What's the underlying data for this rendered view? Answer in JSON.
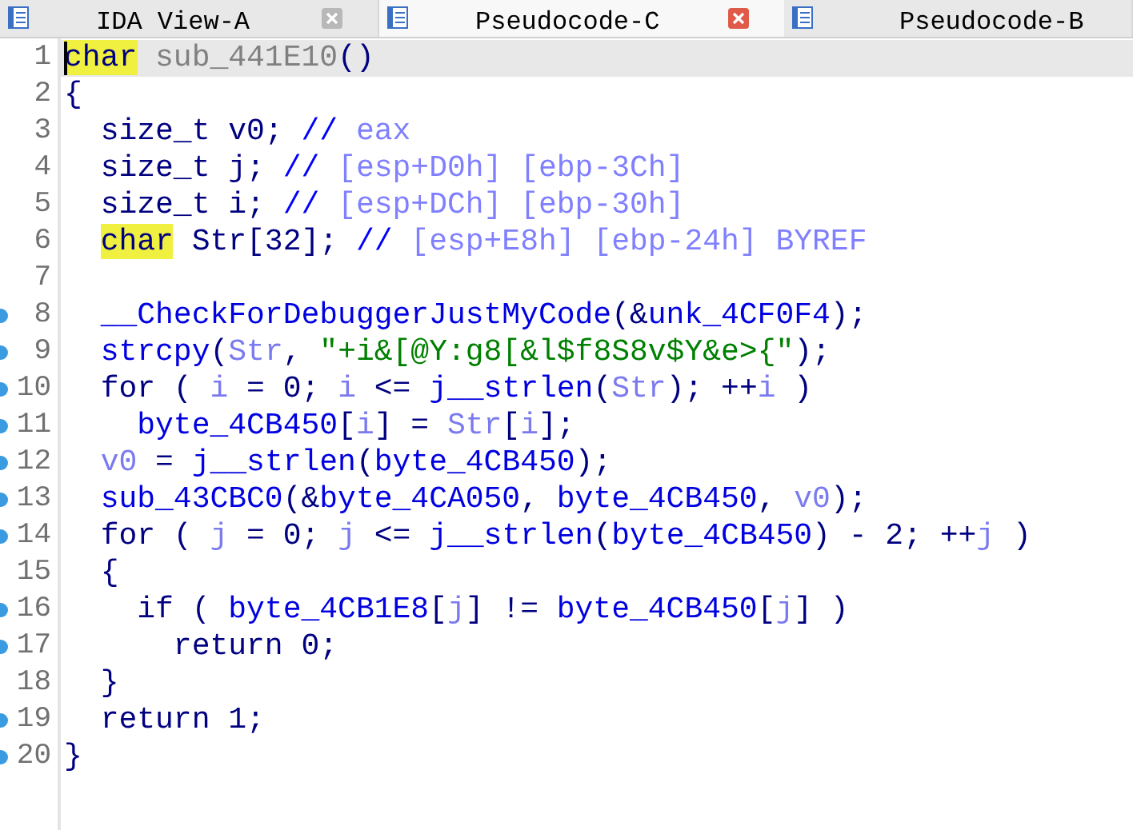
{
  "tabs": [
    {
      "label": "IDA View-A",
      "selected": false,
      "closable": true
    },
    {
      "label": "Pseudocode-C",
      "selected": true,
      "closable": true
    },
    {
      "label": "Pseudocode-B",
      "selected": false,
      "closable": false
    }
  ],
  "lines": [
    {
      "number": "1",
      "dot": false,
      "current": true,
      "segments": [
        {
          "kind": "highlight",
          "text": "char"
        },
        {
          "kind": "name",
          "text": " sub_441E10"
        },
        {
          "kind": "plain",
          "text": "()"
        }
      ]
    },
    {
      "number": "2",
      "dot": false,
      "current": false,
      "segments": [
        {
          "kind": "plain",
          "text": "{"
        }
      ]
    },
    {
      "number": "3",
      "dot": false,
      "current": false,
      "segments": [
        {
          "kind": "plain",
          "text": "  size_t v0; "
        },
        {
          "kind": "comment",
          "text": "// "
        },
        {
          "kind": "note",
          "text": "eax"
        }
      ]
    },
    {
      "number": "4",
      "dot": false,
      "current": false,
      "segments": [
        {
          "kind": "plain",
          "text": "  size_t j; "
        },
        {
          "kind": "comment",
          "text": "// "
        },
        {
          "kind": "note",
          "text": "[esp+D0h] [ebp-3Ch]"
        }
      ]
    },
    {
      "number": "5",
      "dot": false,
      "current": false,
      "segments": [
        {
          "kind": "plain",
          "text": "  size_t i; "
        },
        {
          "kind": "comment",
          "text": "// "
        },
        {
          "kind": "note",
          "text": "[esp+DCh] [ebp-30h]"
        }
      ]
    },
    {
      "number": "6",
      "dot": false,
      "current": false,
      "segments": [
        {
          "kind": "highlight",
          "text": "  char"
        },
        {
          "kind": "plain",
          "text": " Str[32]; "
        },
        {
          "kind": "comment",
          "text": "// "
        },
        {
          "kind": "note",
          "text": "[esp+E8h] [ebp-24h] BYREF"
        }
      ]
    },
    {
      "number": "7",
      "dot": false,
      "current": false
    },
    {
      "number": "8",
      "dot": true,
      "current": false,
      "segments": [
        {
          "kind": "global",
          "text": "  __CheckForDebuggerJustMyCode"
        },
        {
          "kind": "plain",
          "text": "(&"
        },
        {
          "kind": "global",
          "text": "unk_4CF0F4"
        },
        {
          "kind": "plain",
          "text": ");"
        }
      ]
    },
    {
      "number": "9",
      "dot": true,
      "current": false,
      "segments": [
        {
          "kind": "global",
          "text": "  strcpy"
        },
        {
          "kind": "plain",
          "text": "("
        },
        {
          "kind": "local",
          "text": "Str"
        },
        {
          "kind": "plain",
          "text": ", "
        },
        {
          "kind": "string",
          "text": "\"+i&[@Y:g8[&l$f8S8v$Y&e>{\""
        },
        {
          "kind": "plain",
          "text": ");"
        }
      ]
    },
    {
      "number": "10",
      "dot": true,
      "current": false,
      "segments": [
        {
          "kind": "plain",
          "text": "  for ( "
        },
        {
          "kind": "local",
          "text": "i"
        },
        {
          "kind": "plain",
          "text": " = 0; "
        },
        {
          "kind": "local",
          "text": "i"
        },
        {
          "kind": "plain",
          "text": " <= "
        },
        {
          "kind": "global",
          "text": "j__strlen"
        },
        {
          "kind": "plain",
          "text": "("
        },
        {
          "kind": "local",
          "text": "Str"
        },
        {
          "kind": "plain",
          "text": "); ++"
        },
        {
          "kind": "local",
          "text": "i"
        },
        {
          "kind": "plain",
          "text": " )"
        }
      ]
    },
    {
      "number": "11",
      "dot": true,
      "current": false,
      "segments": [
        {
          "kind": "global",
          "text": "    byte_4CB450"
        },
        {
          "kind": "plain",
          "text": "["
        },
        {
          "kind": "local",
          "text": "i"
        },
        {
          "kind": "plain",
          "text": "] = "
        },
        {
          "kind": "local",
          "text": "Str"
        },
        {
          "kind": "plain",
          "text": "["
        },
        {
          "kind": "local",
          "text": "i"
        },
        {
          "kind": "plain",
          "text": "];"
        }
      ]
    },
    {
      "number": "12",
      "dot": true,
      "current": false,
      "segments": [
        {
          "kind": "local",
          "text": "  v0"
        },
        {
          "kind": "plain",
          "text": " = "
        },
        {
          "kind": "global",
          "text": "j__strlen"
        },
        {
          "kind": "plain",
          "text": "("
        },
        {
          "kind": "global",
          "text": "byte_4CB450"
        },
        {
          "kind": "plain",
          "text": ");"
        }
      ]
    },
    {
      "number": "13",
      "dot": true,
      "current": false,
      "segments": [
        {
          "kind": "global",
          "text": "  sub_43CBC0"
        },
        {
          "kind": "plain",
          "text": "(&"
        },
        {
          "kind": "global",
          "text": "byte_4CA050"
        },
        {
          "kind": "plain",
          "text": ", "
        },
        {
          "kind": "global",
          "text": "byte_4CB450"
        },
        {
          "kind": "plain",
          "text": ", "
        },
        {
          "kind": "local",
          "text": "v0"
        },
        {
          "kind": "plain",
          "text": ");"
        }
      ]
    },
    {
      "number": "14",
      "dot": true,
      "current": false,
      "segments": [
        {
          "kind": "plain",
          "text": "  for ( "
        },
        {
          "kind": "local",
          "text": "j"
        },
        {
          "kind": "plain",
          "text": " = 0; "
        },
        {
          "kind": "local",
          "text": "j"
        },
        {
          "kind": "plain",
          "text": " <= "
        },
        {
          "kind": "global",
          "text": "j__strlen"
        },
        {
          "kind": "plain",
          "text": "("
        },
        {
          "kind": "global",
          "text": "byte_4CB450"
        },
        {
          "kind": "plain",
          "text": ") - 2; ++"
        },
        {
          "kind": "local",
          "text": "j"
        },
        {
          "kind": "plain",
          "text": " )"
        }
      ]
    },
    {
      "number": "15",
      "dot": false,
      "current": false,
      "segments": [
        {
          "kind": "plain",
          "text": "  {"
        }
      ]
    },
    {
      "number": "16",
      "dot": true,
      "current": false,
      "segments": [
        {
          "kind": "plain",
          "text": "    if ( "
        },
        {
          "kind": "global",
          "text": "byte_4CB1E8"
        },
        {
          "kind": "plain",
          "text": "["
        },
        {
          "kind": "local",
          "text": "j"
        },
        {
          "kind": "plain",
          "text": "] != "
        },
        {
          "kind": "global",
          "text": "byte_4CB450"
        },
        {
          "kind": "plain",
          "text": "["
        },
        {
          "kind": "local",
          "text": "j"
        },
        {
          "kind": "plain",
          "text": "] )"
        }
      ]
    },
    {
      "number": "17",
      "dot": true,
      "current": false,
      "segments": [
        {
          "kind": "plain",
          "text": "      return 0;"
        }
      ]
    },
    {
      "number": "18",
      "dot": false,
      "current": false,
      "segments": [
        {
          "kind": "plain",
          "text": "  }"
        }
      ]
    },
    {
      "number": "19",
      "dot": true,
      "current": false,
      "segments": [
        {
          "kind": "plain",
          "text": "  return 1;"
        }
      ]
    },
    {
      "number": "20",
      "dot": true,
      "current": false,
      "segments": [
        {
          "kind": "plain",
          "text": "}"
        }
      ]
    }
  ]
}
